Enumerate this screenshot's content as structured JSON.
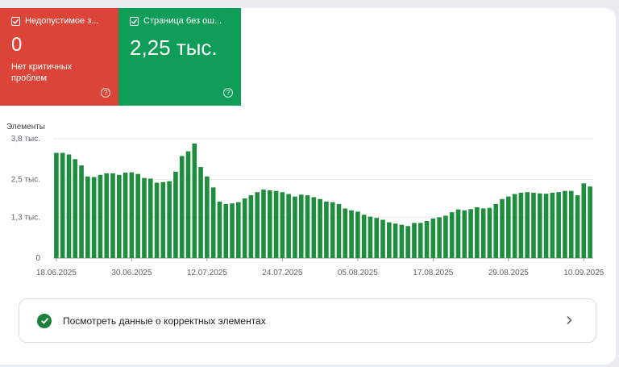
{
  "tiles": [
    {
      "label": "Недопустимое з...",
      "value": "0",
      "sub": "Нет критичных проблем",
      "color": "#db4437"
    },
    {
      "label": "Страница без ош...",
      "value": "2,25 тыс.",
      "sub": "",
      "color": "#0f9d58"
    }
  ],
  "icons": {
    "help": "?",
    "check": "check-icon",
    "chevron": "chevron-right-icon"
  },
  "link_row": {
    "label": "Посмотреть данные о корректных элементах"
  },
  "chart_data": {
    "type": "bar",
    "title": "",
    "ylabel": "Элементы",
    "ylim": [
      0,
      3800
    ],
    "y_ticks": [
      {
        "value": 0,
        "label": "0"
      },
      {
        "value": 1300,
        "label": "1,3 тыс."
      },
      {
        "value": 2500,
        "label": "2,5 тыс."
      },
      {
        "value": 3800,
        "label": "3,8 тыс."
      }
    ],
    "x_tick_labels": [
      "18.06.2025",
      "30.06.2025",
      "12.07.2025",
      "24.07.2025",
      "05.08.2025",
      "17.08.2025",
      "29.08.2025",
      "10.09.2025"
    ],
    "x_tick_index": [
      0,
      12,
      24,
      36,
      48,
      60,
      72,
      84
    ],
    "bar_color": "#1e8e3e",
    "grid": true,
    "values": [
      3350,
      3350,
      3300,
      3150,
      2950,
      2600,
      2580,
      2650,
      2700,
      2700,
      2650,
      2720,
      2730,
      2680,
      2550,
      2530,
      2400,
      2420,
      2450,
      2750,
      3250,
      3400,
      3650,
      2900,
      2600,
      2250,
      1800,
      1720,
      1740,
      1780,
      1900,
      2000,
      2100,
      2180,
      2160,
      2140,
      2100,
      2040,
      1960,
      2020,
      2000,
      1940,
      1880,
      1800,
      1780,
      1720,
      1580,
      1520,
      1480,
      1380,
      1320,
      1280,
      1220,
      1140,
      1100,
      1060,
      1020,
      1120,
      1120,
      1180,
      1260,
      1300,
      1350,
      1460,
      1550,
      1520,
      1560,
      1620,
      1580,
      1600,
      1720,
      1880,
      1960,
      2040,
      2080,
      2100,
      2080,
      2060,
      2050,
      2080,
      2100,
      2140,
      2140,
      2000,
      2380,
      2280
    ]
  }
}
